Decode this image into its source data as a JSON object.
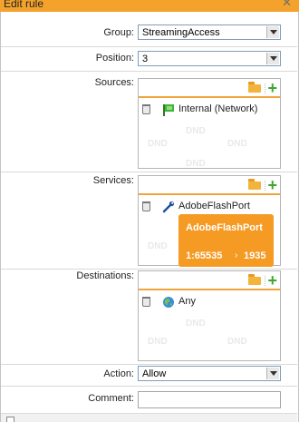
{
  "window": {
    "title": "Edit rule"
  },
  "group": {
    "label": "Group:",
    "value": "StreamingAccess"
  },
  "position": {
    "label": "Position:",
    "value": "3"
  },
  "sources": {
    "label": "Sources:",
    "dnd": "DND",
    "items": [
      {
        "label": "Internal (Network)",
        "icon": "network-flag-icon"
      }
    ]
  },
  "services": {
    "label": "Services:",
    "dnd": "DND",
    "items": [
      {
        "label": "AdobeFlashPort",
        "icon": "service-wrench-icon"
      }
    ],
    "tooltip": {
      "title": "AdobeFlashPort",
      "from": "1:65535",
      "arrow": "›",
      "to": "1935"
    }
  },
  "destinations": {
    "label": "Destinations:",
    "dnd": "DND",
    "items": [
      {
        "label": "Any",
        "icon": "globe-icon"
      }
    ]
  },
  "action": {
    "label": "Action:",
    "value": "Allow"
  },
  "comment": {
    "label": "Comment:",
    "value": ""
  },
  "colors": {
    "accent": "#f59a23",
    "add": "#3aa831",
    "border_accent": "#f0a43a"
  }
}
